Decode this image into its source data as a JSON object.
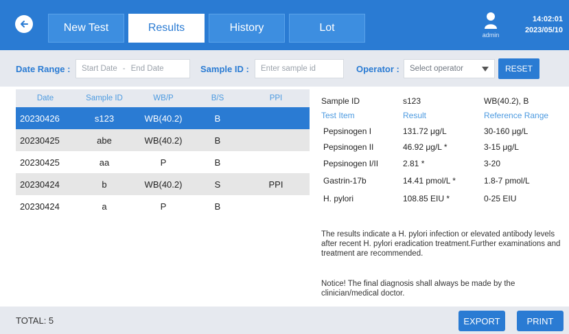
{
  "header": {
    "tabs": [
      {
        "label": "New Test",
        "active": false
      },
      {
        "label": "Results",
        "active": true
      },
      {
        "label": "History",
        "active": false
      },
      {
        "label": "Lot",
        "active": false
      }
    ],
    "user": "admin",
    "time": "14:02:01",
    "date": "2023/05/10",
    "icons": {
      "back": "back-arrow-icon",
      "user": "user-icon"
    },
    "colors": {
      "primary": "#2a7bd3",
      "header": "#2a7bd3",
      "selected_row": "#2a7bd3"
    }
  },
  "filters": {
    "date_range_label": "Date Range :",
    "start_date_placeholder": "Start Date",
    "date_separator": "-",
    "end_date_placeholder": "End Date",
    "sample_id_label": "Sample ID :",
    "sample_id_placeholder": "Enter sample id",
    "operator_label": "Operator :",
    "operator_placeholder": "Select operator",
    "reset_label": "RESET"
  },
  "table": {
    "headers": [
      "Date",
      "Sample ID",
      "WB/P",
      "B/S",
      "PPI"
    ],
    "rows": [
      {
        "date": "20230426",
        "sample_id": "s123",
        "wbp": "WB(40.2)",
        "bs": "B",
        "ppi": "",
        "selected": true
      },
      {
        "date": "20230425",
        "sample_id": "abe",
        "wbp": "WB(40.2)",
        "bs": "B",
        "ppi": ""
      },
      {
        "date": "20230425",
        "sample_id": "aa",
        "wbp": "P",
        "bs": "B",
        "ppi": ""
      },
      {
        "date": "20230424",
        "sample_id": "b",
        "wbp": "WB(40.2)",
        "bs": "S",
        "ppi": "PPI"
      },
      {
        "date": "20230424",
        "sample_id": "a",
        "wbp": "P",
        "bs": "B",
        "ppi": ""
      }
    ]
  },
  "detail": {
    "sample_id_label": "Sample ID",
    "sample_id_value": "s123",
    "sample_type": "WB(40.2), B",
    "col_test_item": "Test Item",
    "col_result": "Result",
    "col_reference": "Reference Range",
    "items": [
      {
        "name": "Pepsinogen I",
        "result": "131.72 μg/L",
        "reference": "30-160 μg/L"
      },
      {
        "name": "Pepsinogen II",
        "result": "46.92 μg/L *",
        "reference": "3-15 μg/L"
      },
      {
        "name": "Pepsinogen I/II",
        "result": "2.81  *",
        "reference": "3-20"
      },
      {
        "name": "Gastrin-17b",
        "result": "14.41 pmol/L *",
        "reference": "1.8-7 pmol/L"
      },
      {
        "name": "H. pylori",
        "result": "108.85 EIU *",
        "reference": "0-25 EIU"
      }
    ],
    "interpretation": "The results indicate a H. pylori infection or elevated antibody levels after recent H. pylori eradication treatment.Further examinations and treatment are recommended.",
    "notice": "Notice! The final diagnosis shall always be made by the clinician/medical doctor."
  },
  "footer": {
    "total": "TOTAL: 5",
    "export_label": "EXPORT",
    "print_label": "PRINT"
  }
}
